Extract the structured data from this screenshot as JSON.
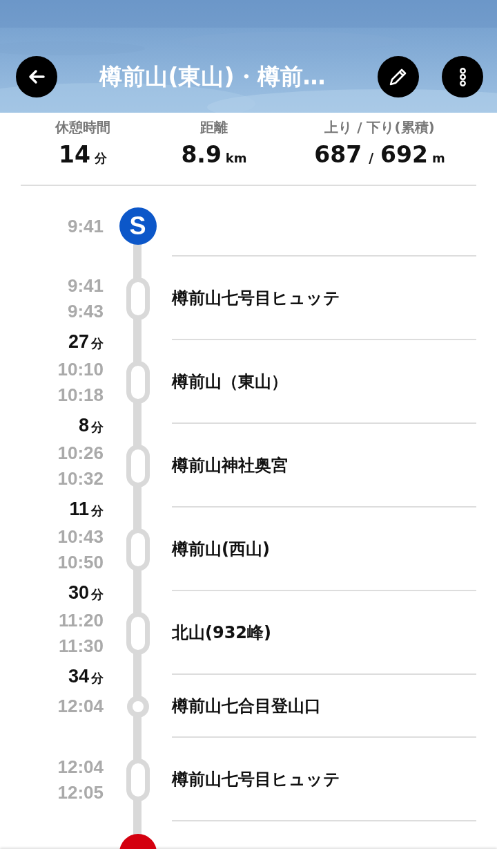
{
  "header": {
    "title": "樽前山(東山)・樽前…",
    "buttons": [
      {
        "kind": "back"
      },
      {
        "kind": "edit"
      },
      {
        "kind": "more"
      }
    ]
  },
  "stats": [
    {
      "label": "休憩時間",
      "values": [
        "14"
      ],
      "unit": "分"
    },
    {
      "label": "距離",
      "values": [
        "8.9"
      ],
      "unit": "km"
    },
    {
      "label": "上り / 下り(累積)",
      "values": [
        "687",
        "692"
      ],
      "separator": "/",
      "unit": "m"
    }
  ],
  "stops": [
    {
      "kind": "start",
      "label": "S",
      "times": [
        "9:41"
      ]
    },
    {
      "kind": "stay",
      "times": [
        "9:41",
        "9:43"
      ],
      "name": "樽前山七号目ヒュッテ"
    },
    {
      "kind": "stay",
      "duration": "27",
      "duration_unit": "分",
      "times": [
        "10:10",
        "10:18"
      ],
      "name": "樽前山（東山）"
    },
    {
      "kind": "stay",
      "duration": "8",
      "duration_unit": "分",
      "times": [
        "10:26",
        "10:32"
      ],
      "name": "樽前山神社奥宮"
    },
    {
      "kind": "stay",
      "duration": "11",
      "duration_unit": "分",
      "times": [
        "10:43",
        "10:50"
      ],
      "name": "樽前山(西山)"
    },
    {
      "kind": "stay",
      "duration": "30",
      "duration_unit": "分",
      "times": [
        "11:20",
        "11:30"
      ],
      "name": "北山(932峰)"
    },
    {
      "kind": "pass",
      "duration": "34",
      "duration_unit": "分",
      "times": [
        "12:04"
      ],
      "name": "樽前山七合目登山口"
    },
    {
      "kind": "stay",
      "times": [
        "12:04",
        "12:05"
      ],
      "name": "樽前山七号目ヒュッテ"
    },
    {
      "kind": "goal"
    }
  ]
}
